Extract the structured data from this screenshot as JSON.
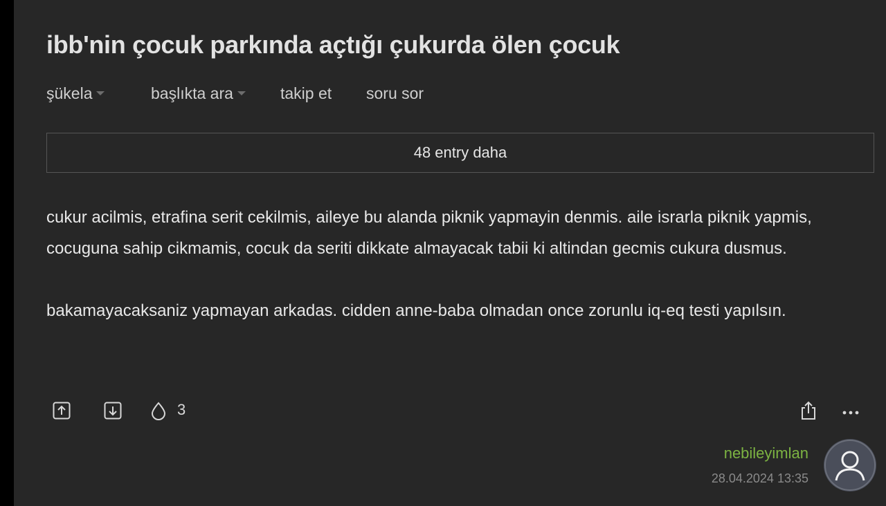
{
  "topic": {
    "title": "ibb'nin çocuk parkında açtığı çukurda ölen çocuk"
  },
  "subnav": {
    "sort_label": "şükela",
    "search_in_topic_label": "başlıkta ara",
    "follow_label": "takip et",
    "ask_label": "soru sor"
  },
  "more_entries": {
    "label": "48 entry daha"
  },
  "entry": {
    "paragraph_1": "cukur acilmis, etrafina serit cekilmis, aileye bu alanda piknik yapmayin denmis. aile israrla piknik yapmis, cocuguna sahip cikmamis, cocuk da seriti dikkate almayacak tabii ki altindan gecmis cukura dusmus.",
    "paragraph_2": "bakamayacaksaniz yapmayan arkadas. cidden anne-baba olmadan once zorunlu iq-eq testi yapılsın.",
    "favorite_count": "3",
    "author": "nebileyimlan",
    "timestamp": "28.04.2024 13:35"
  },
  "icons": {
    "upvote": "arrow-up-box-icon",
    "downvote": "arrow-down-box-icon",
    "favorite": "drop-icon",
    "share": "share-icon",
    "more": "ellipsis-icon",
    "avatar": "user-avatar-icon"
  },
  "colors": {
    "background": "#272727",
    "author": "#7cb342",
    "text": "#e8e8e8"
  }
}
